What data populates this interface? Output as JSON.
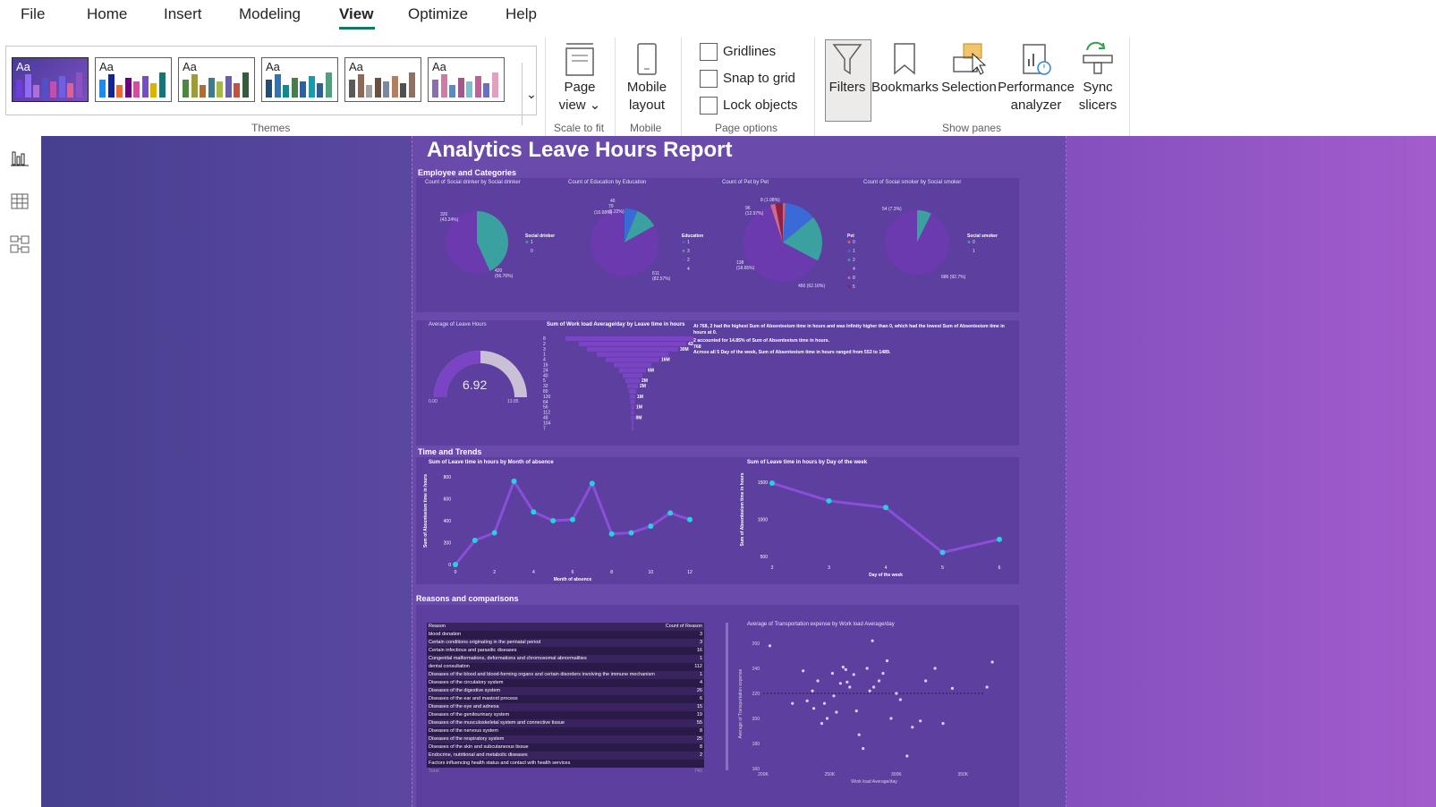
{
  "menu": {
    "items": [
      "File",
      "Home",
      "Insert",
      "Modeling",
      "View",
      "Optimize",
      "Help"
    ],
    "active": "View"
  },
  "ribbon": {
    "themes": {
      "label": "Themes",
      "thumb_text": "Aa",
      "swatches": [
        [
          "#6d3fd8",
          "#8e6bf0",
          "#b06dd6",
          "#5050c8",
          "#c04fb0",
          "#7060e0",
          "#e06090",
          "#9050c0"
        ],
        [
          "#118dff",
          "#12239e",
          "#e66c37",
          "#6b007b",
          "#e044a7",
          "#744ec2",
          "#d9b300",
          "#197278"
        ],
        [
          "#4e8542",
          "#9c9c3a",
          "#b56a2e",
          "#3a7d8c",
          "#a6b846",
          "#6b5ea8",
          "#c74f3e",
          "#335c3a"
        ],
        [
          "#1f4e79",
          "#2e75b6",
          "#108a8a",
          "#4b7a4b",
          "#2a5fb0",
          "#0aa0b0",
          "#306090",
          "#50a080"
        ],
        [
          "#5a5a5a",
          "#8a6b5a",
          "#a0a0a0",
          "#6b4f3a",
          "#7a8a9a",
          "#b08060",
          "#505050",
          "#907060"
        ],
        [
          "#8a6fb0",
          "#d07aa8",
          "#5a8ac0",
          "#a05a8a",
          "#7ac0d0",
          "#c0609a",
          "#6a70c0",
          "#e0a0c0"
        ]
      ]
    },
    "scale": {
      "line1": "Page",
      "line2": "view",
      "chevron": "⌄",
      "label": "Scale to fit"
    },
    "mobile": {
      "line1": "Mobile",
      "line2": "layout",
      "label": "Mobile"
    },
    "page_options": {
      "label": "Page options",
      "items": [
        {
          "label": "Gridlines",
          "checked": false
        },
        {
          "label": "Snap to grid",
          "checked": false
        },
        {
          "label": "Lock objects",
          "checked": false
        }
      ]
    },
    "show_panes": {
      "label": "Show panes",
      "filters": "Filters",
      "bookmarks": "Bookmarks",
      "selection": "Selection",
      "performance_1": "Performance",
      "performance_2": "analyzer",
      "sync_1": "Sync",
      "sync_2": "slicers"
    }
  },
  "report": {
    "title": "Analytics Leave Hours Report",
    "sections": {
      "employee": "Employee and Categories",
      "time": "Time and Trends",
      "reasons": "Reasons and comparisons"
    },
    "pies": [
      {
        "title": "Count of Social drinker by Social drinker",
        "legend_title": "Social drinker",
        "legend": [
          "1",
          "0"
        ],
        "labels": [
          "320\n(43.24%)",
          "420\n(56.76%)"
        ]
      },
      {
        "title": "Count of Education by Education",
        "legend_title": "Education",
        "legend": [
          "1",
          "3",
          "2",
          "4"
        ],
        "labels": [
          "46",
          "79\n(6.22%)",
          "(10.68%)",
          "611\n(82.57%)"
        ]
      },
      {
        "title": "Count of Pet by Pet",
        "legend_title": "Pet",
        "legend": [
          "0",
          "1",
          "2",
          "4",
          "8",
          "5"
        ],
        "labels": [
          "8 (1.08%)",
          "96\n(12.97%)",
          "138\n(18.65%)",
          "460 (62.16%)"
        ]
      },
      {
        "title": "Count of Social smoker by Social smoker",
        "legend_title": "Social smoker",
        "legend": [
          "0",
          "1"
        ],
        "labels": [
          "54 (7.3%)",
          "686 (92.7%)"
        ]
      }
    ],
    "gauge": {
      "title": "Average of Leave Hours",
      "value": "6.92",
      "min": "0.00",
      "max": "13.85",
      "fill_fraction": 0.5
    },
    "funnel": {
      "title": "Sum of Work load Average/day by Leave time in hours",
      "categories": [
        "8",
        "2",
        "3",
        "1",
        "4",
        "16",
        "24",
        "40",
        "5",
        "32",
        "80",
        "120",
        "64",
        "56",
        "112",
        "48",
        "104",
        "7"
      ],
      "bar_labels": [
        "42M",
        "30M",
        "16M",
        "6M",
        "2M",
        "2M",
        "1M",
        "1M",
        "0M"
      ]
    },
    "narrative": {
      "p1": "At 768, 2 had the highest Sum of Absenteeism time in hours and was Infinity higher than 0, which had the lowest Sum of Absenteeism time in hours at 0.",
      "p2": "2 accounted for 14.85% of Sum of Absenteeism time in hours.",
      "p3": "768",
      "p4": "Across all 5 Day of the week, Sum of Absenteeism time in hours ranged from 553 to 1489."
    },
    "table": {
      "col1": "Reason",
      "col2": "Count of Reason",
      "rows": [
        [
          "blood donation",
          "3"
        ],
        [
          "Certain conditions originating in the perinatal period",
          "3"
        ],
        [
          "Certain infectious and parasitic diseases",
          "16"
        ],
        [
          "Congenital malformations, deformations and chromosomal abnormalities",
          "1"
        ],
        [
          "dental consultation",
          "112"
        ],
        [
          "Diseases of the blood and blood-forming organs and certain disorders involving the immune mechanism",
          "1"
        ],
        [
          "Diseases of the circulatory system",
          "4"
        ],
        [
          "Diseases of the digestive system",
          "26"
        ],
        [
          "Diseases of the ear and mastoid process",
          "6"
        ],
        [
          "Diseases of the eye and adnexa",
          "15"
        ],
        [
          "Diseases of the genitourinary system",
          "19"
        ],
        [
          "Diseases of the musculoskeletal system and connective tissue",
          "55"
        ],
        [
          "Diseases of the nervous system",
          "8"
        ],
        [
          "Diseases of the respiratory system",
          "25"
        ],
        [
          "Diseases of the skin and subcutaneous tissue",
          "8"
        ],
        [
          "Endocrine, nutritional and metabolic diseases",
          "2"
        ],
        [
          "Factors influencing health status and contact with health services",
          ""
        ]
      ],
      "total_label": "Total",
      "total_value": "740"
    }
  },
  "chart_data": [
    {
      "type": "line",
      "title": "Sum of Leave time in hours by Month of absence",
      "xlabel": "Month of absence",
      "ylabel": "Sum of Absenteeism time in hours",
      "x": [
        0,
        1,
        2,
        3,
        4,
        5,
        6,
        7,
        8,
        9,
        10,
        11,
        12
      ],
      "values": [
        0,
        220,
        290,
        760,
        480,
        400,
        410,
        740,
        280,
        290,
        350,
        470,
        410
      ],
      "xticks": [
        "0",
        "2",
        "4",
        "6",
        "8",
        "10",
        "12"
      ],
      "yticks": [
        "0",
        "200",
        "400",
        "600",
        "800"
      ],
      "ylim": [
        0,
        800
      ]
    },
    {
      "type": "line",
      "title": "Sum of Leave time in hours by Day of the week",
      "xlabel": "Day of the week",
      "ylabel": "Sum of Absenteeism time in hours",
      "x": [
        2,
        3,
        4,
        5,
        6
      ],
      "values": [
        1489,
        1250,
        1160,
        553,
        730
      ],
      "xticks": [
        "2",
        "3",
        "4",
        "5",
        "6"
      ],
      "yticks": [
        "500",
        "1000",
        "1500"
      ],
      "ylim": [
        450,
        1550
      ]
    },
    {
      "type": "scatter",
      "title": "Average of Transportation expense by Work load Average/day",
      "xlabel": "Work load Average/day",
      "ylabel": "Average of Transportation expense",
      "xticks": [
        "200K",
        "250K",
        "300K",
        "350K"
      ],
      "yticks": [
        "160",
        "180",
        "200",
        "220",
        "240",
        "260"
      ],
      "xlim": [
        200000,
        380000
      ],
      "ylim": [
        160,
        265
      ],
      "trend_value": 220,
      "points": [
        [
          205000,
          258
        ],
        [
          222000,
          212
        ],
        [
          230000,
          238
        ],
        [
          233000,
          214
        ],
        [
          237000,
          222
        ],
        [
          238000,
          208
        ],
        [
          241000,
          230
        ],
        [
          244000,
          196
        ],
        [
          246000,
          212
        ],
        [
          248000,
          200
        ],
        [
          252000,
          236
        ],
        [
          253000,
          218
        ],
        [
          255000,
          205
        ],
        [
          258000,
          228
        ],
        [
          260000,
          241
        ],
        [
          262000,
          239
        ],
        [
          263000,
          229
        ],
        [
          265000,
          225
        ],
        [
          268000,
          235
        ],
        [
          270000,
          206
        ],
        [
          272000,
          187
        ],
        [
          275000,
          176
        ],
        [
          278000,
          240
        ],
        [
          280000,
          222
        ],
        [
          282000,
          262
        ],
        [
          283000,
          225
        ],
        [
          287000,
          230
        ],
        [
          290000,
          236
        ],
        [
          293000,
          246
        ],
        [
          296000,
          200
        ],
        [
          300000,
          220
        ],
        [
          303000,
          215
        ],
        [
          308000,
          170
        ],
        [
          312000,
          193
        ],
        [
          318000,
          198
        ],
        [
          322000,
          230
        ],
        [
          329000,
          240
        ],
        [
          335000,
          196
        ],
        [
          342000,
          224
        ],
        [
          368000,
          225
        ],
        [
          372000,
          245
        ]
      ]
    }
  ]
}
